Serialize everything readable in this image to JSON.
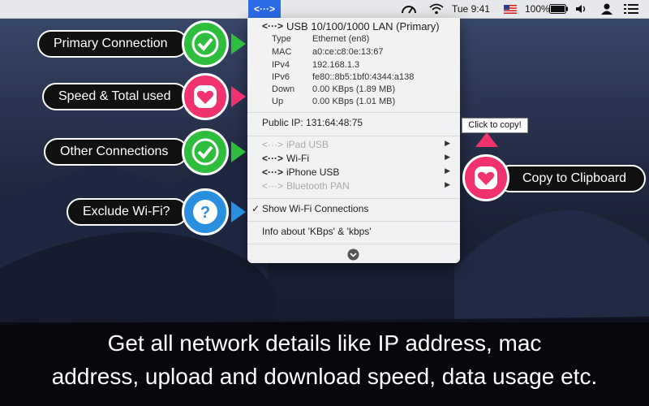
{
  "menubar": {
    "app_icon": "<···>",
    "clock": "Tue 9:41",
    "battery": "100%",
    "icons": [
      "speedometer-icon",
      "wifi-icon",
      "flag-icon",
      "battery-icon",
      "volume-icon",
      "user-icon",
      "list-icon"
    ]
  },
  "menu": {
    "primary_title": "USB 10/100/1000 LAN (Primary)",
    "details": [
      {
        "label": "Type",
        "value": "Ethernet (en8)"
      },
      {
        "label": "MAC",
        "value": "a0:ce:c8:0e:13:67"
      },
      {
        "label": "IPv4",
        "value": "192.168.1.3"
      },
      {
        "label": "IPv6",
        "value": "fe80::8b5:1bf0:4344:a138"
      },
      {
        "label": "Down",
        "value": "0.00 KBps (1.89 MB)"
      },
      {
        "label": "Up",
        "value": "0.00 KBps (1.01 MB)"
      }
    ],
    "public_ip": "Public IP:  131:64:48:75",
    "connections": [
      {
        "label": "iPad USB",
        "enabled": false
      },
      {
        "label": "Wi-Fi",
        "enabled": true
      },
      {
        "label": "iPhone USB",
        "enabled": true
      },
      {
        "label": "Bluetooth PAN",
        "enabled": false
      }
    ],
    "show_wifi": "Show Wi-Fi Connections",
    "info": "Info about 'KBps' & 'kbps'"
  },
  "callouts": {
    "primary": "Primary Connection",
    "speed": "Speed & Total used",
    "other": "Other Connections",
    "exclude": "Exclude Wi-Fi?",
    "copy": "Copy to Clipboard"
  },
  "tooltip": "Click to copy!",
  "caption": {
    "line1": "Get all network details like IP address, mac",
    "line2": "address, upload and download speed, data usage etc."
  },
  "colors": {
    "green": "#2fbd3d",
    "pink": "#f0336e",
    "blue": "#2a8fde",
    "menu_highlight": "#2d6ce8"
  }
}
